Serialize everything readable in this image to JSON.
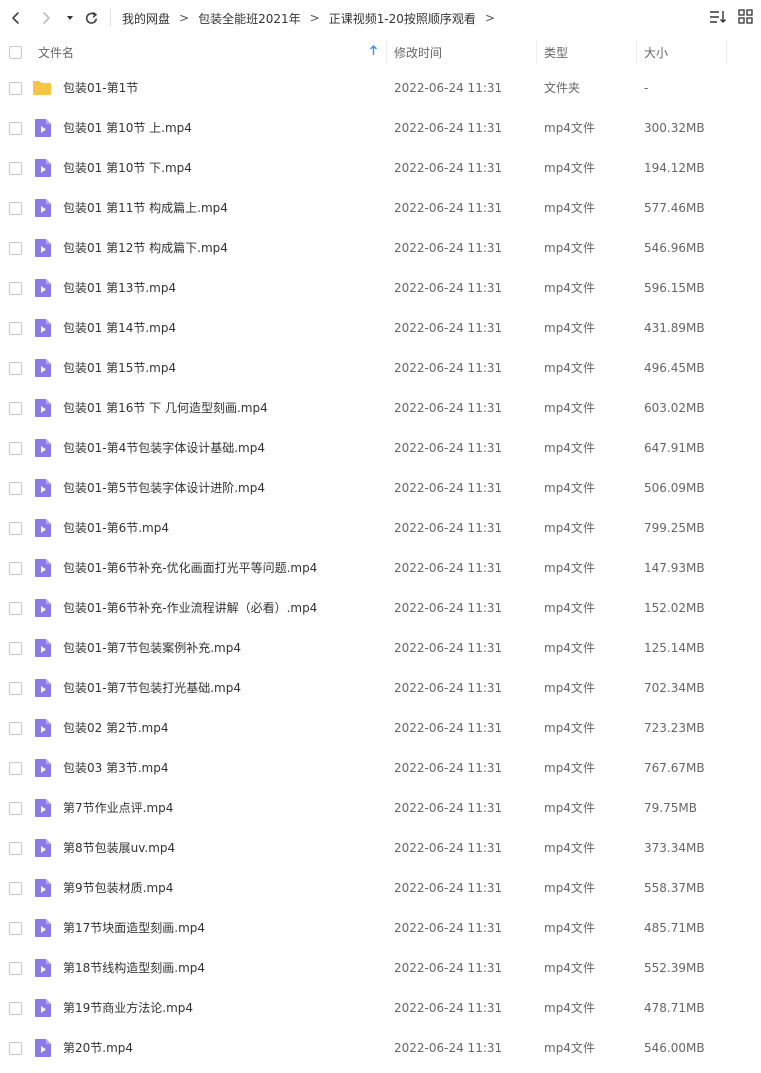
{
  "nav": {
    "back_icon": "chevron-left-icon",
    "forward_icon": "chevron-right-icon",
    "dropdown_icon": "caret-down-icon",
    "refresh_icon": "refresh-icon"
  },
  "breadcrumb": {
    "items": [
      "我的网盘",
      "包装全能班2021年",
      "正课视频1-20按照顺序观看"
    ],
    "separator": ">"
  },
  "toolbar": {
    "sort_icon": "sort-list-icon",
    "grid_icon": "grid-view-icon"
  },
  "columns": {
    "name": "文件名",
    "modified": "修改时间",
    "type": "类型",
    "size": "大小"
  },
  "colors": {
    "folder": "#f7c544",
    "video_icon": "#8a7be8",
    "sort_arrow": "#3b8ff0"
  },
  "files": [
    {
      "name": "包装01-第1节",
      "time": "2022-06-24 11:31",
      "type": "文件夹",
      "size": "-",
      "icon": "folder-icon"
    },
    {
      "name": "包装01 第10节 上.mp4",
      "time": "2022-06-24 11:31",
      "type": "mp4文件",
      "size": "300.32MB",
      "icon": "video-file-icon"
    },
    {
      "name": "包装01 第10节 下.mp4",
      "time": "2022-06-24 11:31",
      "type": "mp4文件",
      "size": "194.12MB",
      "icon": "video-file-icon"
    },
    {
      "name": "包装01 第11节 构成篇上.mp4",
      "time": "2022-06-24 11:31",
      "type": "mp4文件",
      "size": "577.46MB",
      "icon": "video-file-icon"
    },
    {
      "name": "包装01 第12节 构成篇下.mp4",
      "time": "2022-06-24 11:31",
      "type": "mp4文件",
      "size": "546.96MB",
      "icon": "video-file-icon"
    },
    {
      "name": "包装01 第13节.mp4",
      "time": "2022-06-24 11:31",
      "type": "mp4文件",
      "size": "596.15MB",
      "icon": "video-file-icon"
    },
    {
      "name": "包装01 第14节.mp4",
      "time": "2022-06-24 11:31",
      "type": "mp4文件",
      "size": "431.89MB",
      "icon": "video-file-icon"
    },
    {
      "name": "包装01 第15节.mp4",
      "time": "2022-06-24 11:31",
      "type": "mp4文件",
      "size": "496.45MB",
      "icon": "video-file-icon"
    },
    {
      "name": "包装01 第16节 下 几何造型刻画.mp4",
      "time": "2022-06-24 11:31",
      "type": "mp4文件",
      "size": "603.02MB",
      "icon": "video-file-icon"
    },
    {
      "name": "包装01-第4节包装字体设计基础.mp4",
      "time": "2022-06-24 11:31",
      "type": "mp4文件",
      "size": "647.91MB",
      "icon": "video-file-icon"
    },
    {
      "name": "包装01-第5节包装字体设计进阶.mp4",
      "time": "2022-06-24 11:31",
      "type": "mp4文件",
      "size": "506.09MB",
      "icon": "video-file-icon"
    },
    {
      "name": "包装01-第6节.mp4",
      "time": "2022-06-24 11:31",
      "type": "mp4文件",
      "size": "799.25MB",
      "icon": "video-file-icon"
    },
    {
      "name": "包装01-第6节补充-优化画面打光平等问题.mp4",
      "time": "2022-06-24 11:31",
      "type": "mp4文件",
      "size": "147.93MB",
      "icon": "video-file-icon"
    },
    {
      "name": "包装01-第6节补充-作业流程讲解（必看）.mp4",
      "time": "2022-06-24 11:31",
      "type": "mp4文件",
      "size": "152.02MB",
      "icon": "video-file-icon"
    },
    {
      "name": "包装01-第7节包装案例补充.mp4",
      "time": "2022-06-24 11:31",
      "type": "mp4文件",
      "size": "125.14MB",
      "icon": "video-file-icon"
    },
    {
      "name": "包装01-第7节包装打光基础.mp4",
      "time": "2022-06-24 11:31",
      "type": "mp4文件",
      "size": "702.34MB",
      "icon": "video-file-icon"
    },
    {
      "name": "包装02 第2节.mp4",
      "time": "2022-06-24 11:31",
      "type": "mp4文件",
      "size": "723.23MB",
      "icon": "video-file-icon"
    },
    {
      "name": "包装03 第3节.mp4",
      "time": "2022-06-24 11:31",
      "type": "mp4文件",
      "size": "767.67MB",
      "icon": "video-file-icon"
    },
    {
      "name": "第7节作业点评.mp4",
      "time": "2022-06-24 11:31",
      "type": "mp4文件",
      "size": "79.75MB",
      "icon": "video-file-icon"
    },
    {
      "name": "第8节包装展uv.mp4",
      "time": "2022-06-24 11:31",
      "type": "mp4文件",
      "size": "373.34MB",
      "icon": "video-file-icon"
    },
    {
      "name": "第9节包装材质.mp4",
      "time": "2022-06-24 11:31",
      "type": "mp4文件",
      "size": "558.37MB",
      "icon": "video-file-icon"
    },
    {
      "name": "第17节块面造型刻画.mp4",
      "time": "2022-06-24 11:31",
      "type": "mp4文件",
      "size": "485.71MB",
      "icon": "video-file-icon"
    },
    {
      "name": "第18节线构造型刻画.mp4",
      "time": "2022-06-24 11:31",
      "type": "mp4文件",
      "size": "552.39MB",
      "icon": "video-file-icon"
    },
    {
      "name": "第19节商业方法论.mp4",
      "time": "2022-06-24 11:31",
      "type": "mp4文件",
      "size": "478.71MB",
      "icon": "video-file-icon"
    },
    {
      "name": "第20节.mp4",
      "time": "2022-06-24 11:31",
      "type": "mp4文件",
      "size": "546.00MB",
      "icon": "video-file-icon"
    }
  ]
}
